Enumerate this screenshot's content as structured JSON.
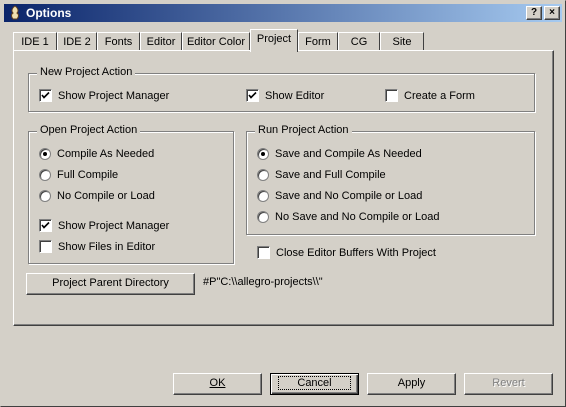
{
  "window": {
    "title": "Options"
  },
  "titlebar_buttons": {
    "help": "?",
    "close": "×"
  },
  "tabs": [
    {
      "label": "IDE 1"
    },
    {
      "label": "IDE 2"
    },
    {
      "label": "Fonts"
    },
    {
      "label": "Editor"
    },
    {
      "label": "Editor Color"
    },
    {
      "label": "Project",
      "active": true
    },
    {
      "label": "Form"
    },
    {
      "label": "CG"
    },
    {
      "label": "Site"
    }
  ],
  "new_project": {
    "title": "New Project Action",
    "show_project_manager": {
      "label": "Show Project Manager",
      "checked": true
    },
    "show_editor": {
      "label": "Show Editor",
      "checked": true
    },
    "create_form": {
      "label": "Create a Form",
      "checked": false
    }
  },
  "open_project": {
    "title": "Open Project Action",
    "options": [
      {
        "label": "Compile As Needed",
        "selected": true
      },
      {
        "label": "Full Compile",
        "selected": false
      },
      {
        "label": "No Compile or Load",
        "selected": false
      }
    ],
    "show_project_manager": {
      "label": "Show Project Manager",
      "checked": true
    },
    "show_files_in_editor": {
      "label": "Show Files in Editor",
      "checked": false
    }
  },
  "run_project": {
    "title": "Run Project Action",
    "options": [
      {
        "label": "Save and Compile As Needed",
        "selected": true
      },
      {
        "label": "Save and Full Compile",
        "selected": false
      },
      {
        "label": "Save and No Compile or Load",
        "selected": false
      },
      {
        "label": "No Save and No Compile or Load",
        "selected": false
      }
    ]
  },
  "close_editor_buffers": {
    "label": "Close Editor Buffers With Project",
    "checked": false
  },
  "project_parent_directory": {
    "button_label": "Project Parent Directory",
    "value": "#P\"C:\\\\allegro-projects\\\\\""
  },
  "buttons": {
    "ok": "OK",
    "cancel": "Cancel",
    "apply": "Apply",
    "revert": "Revert"
  }
}
